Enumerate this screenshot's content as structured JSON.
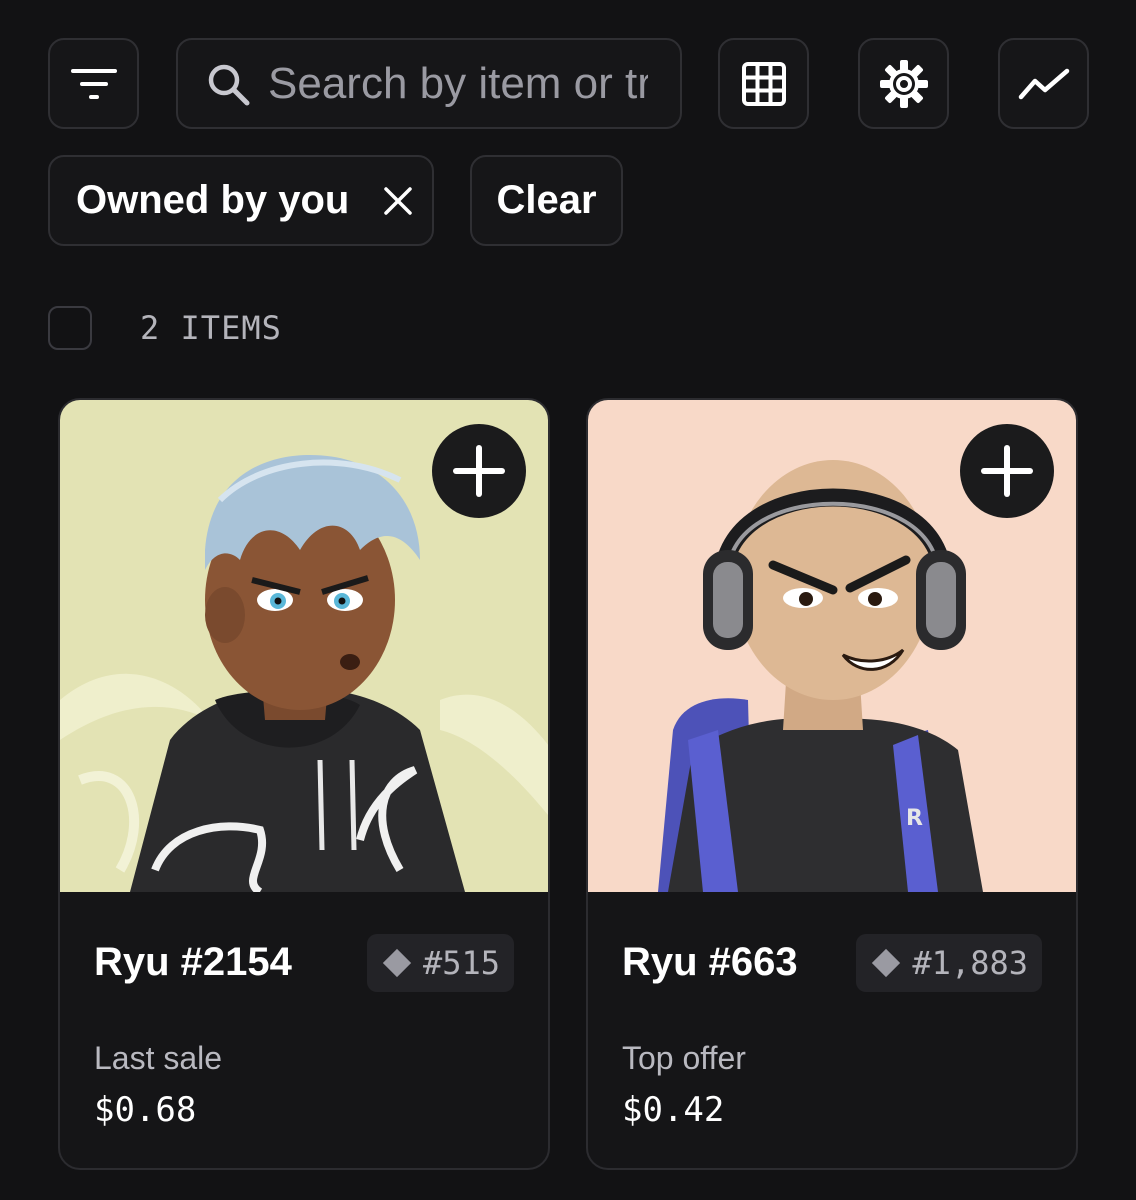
{
  "toolbar": {
    "filter_icon": "filter-icon",
    "search_icon": "search-icon",
    "search_placeholder": "Search by item or trait",
    "grid_icon": "grid-view-icon",
    "settings_icon": "gear-icon",
    "chart_icon": "trend-chart-icon"
  },
  "filters": {
    "active_chip": "Owned by you",
    "clear_label": "Clear"
  },
  "results": {
    "count_label": "2 ITEMS"
  },
  "cards": [
    {
      "name": "Ryu #2154",
      "rank": "#515",
      "price_label": "Last sale",
      "price": "$0.68",
      "bg_color": "#e3e3b4"
    },
    {
      "name": "Ryu #663",
      "rank": "#1,883",
      "price_label": "Top offer",
      "price": "$0.42",
      "bg_color": "#f8d9c8"
    }
  ],
  "colors": {
    "background": "#121214",
    "border": "#2f2f33",
    "muted_text": "#b4b4bb"
  }
}
